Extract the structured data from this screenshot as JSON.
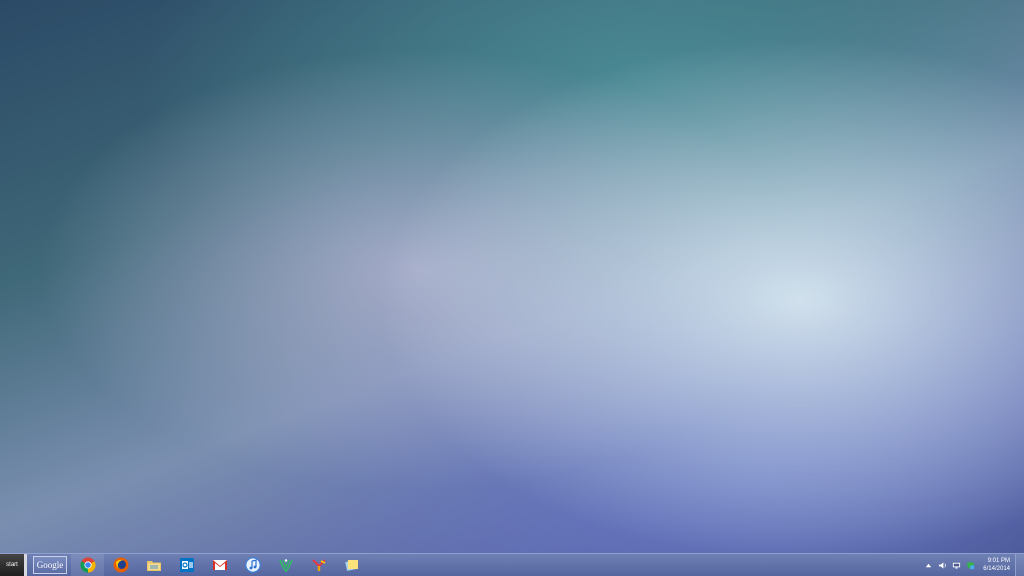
{
  "taskbar": {
    "start_label": "start",
    "search_label": "Google",
    "pinned_apps": [
      {
        "name": "Chrome",
        "icon": "chrome-icon"
      },
      {
        "name": "Firefox",
        "icon": "firefox-icon"
      },
      {
        "name": "File Explorer",
        "icon": "folder-icon"
      },
      {
        "name": "Outlook",
        "icon": "outlook-icon"
      },
      {
        "name": "Gmail",
        "icon": "gmail-icon"
      },
      {
        "name": "iTunes",
        "icon": "itunes-icon"
      },
      {
        "name": "Evernote",
        "icon": "evernote-icon"
      },
      {
        "name": "Yahoo",
        "icon": "yahoo-icon"
      },
      {
        "name": "Sticky Notes",
        "icon": "sticky-notes-icon"
      }
    ],
    "tray": {
      "icons": [
        "chevron-up-icon",
        "volume-icon",
        "network-icon",
        "shield-icon"
      ],
      "time": "9:01 PM",
      "date": "6/14/2014"
    }
  },
  "colors": {
    "taskbar": "#6172aa",
    "start_button": "#2a2a2a"
  }
}
